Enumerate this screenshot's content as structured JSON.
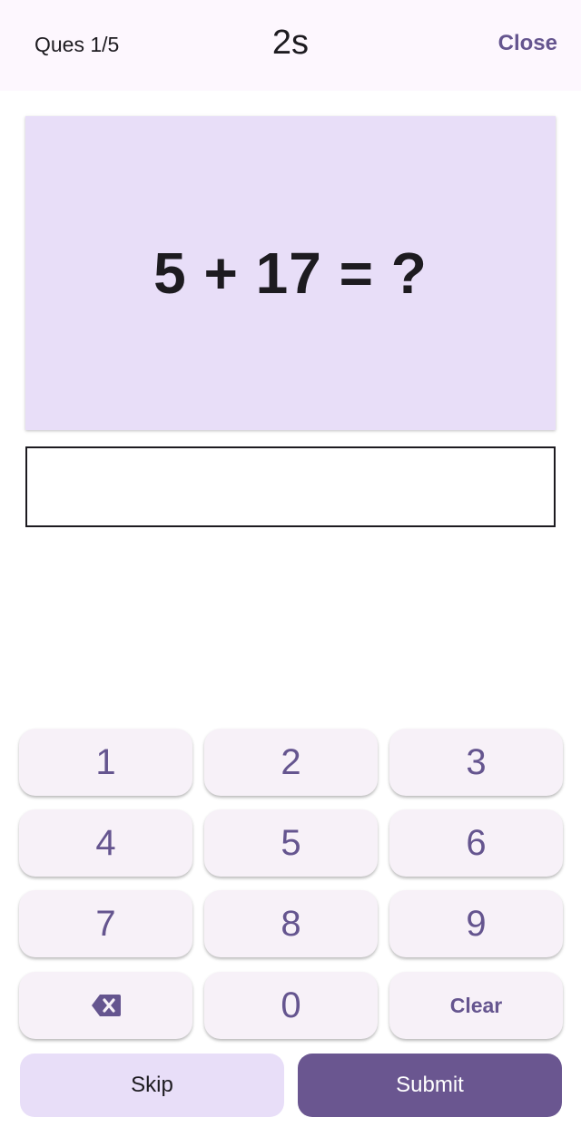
{
  "header": {
    "question_progress": "Ques 1/5",
    "timer": "2s",
    "close_label": "Close"
  },
  "question": {
    "text": "5 + 17 = ?"
  },
  "answer": {
    "value": "",
    "placeholder": ""
  },
  "keypad": {
    "keys": [
      "1",
      "2",
      "3",
      "4",
      "5",
      "6",
      "7",
      "8",
      "9"
    ],
    "zero": "0",
    "clear_label": "Clear",
    "backspace_icon": "backspace-icon"
  },
  "actions": {
    "skip_label": "Skip",
    "submit_label": "Submit"
  },
  "colors": {
    "accent": "#65558f",
    "card": "#e8def8",
    "submit": "#6a5690",
    "key_bg": "#f7f1f8"
  }
}
